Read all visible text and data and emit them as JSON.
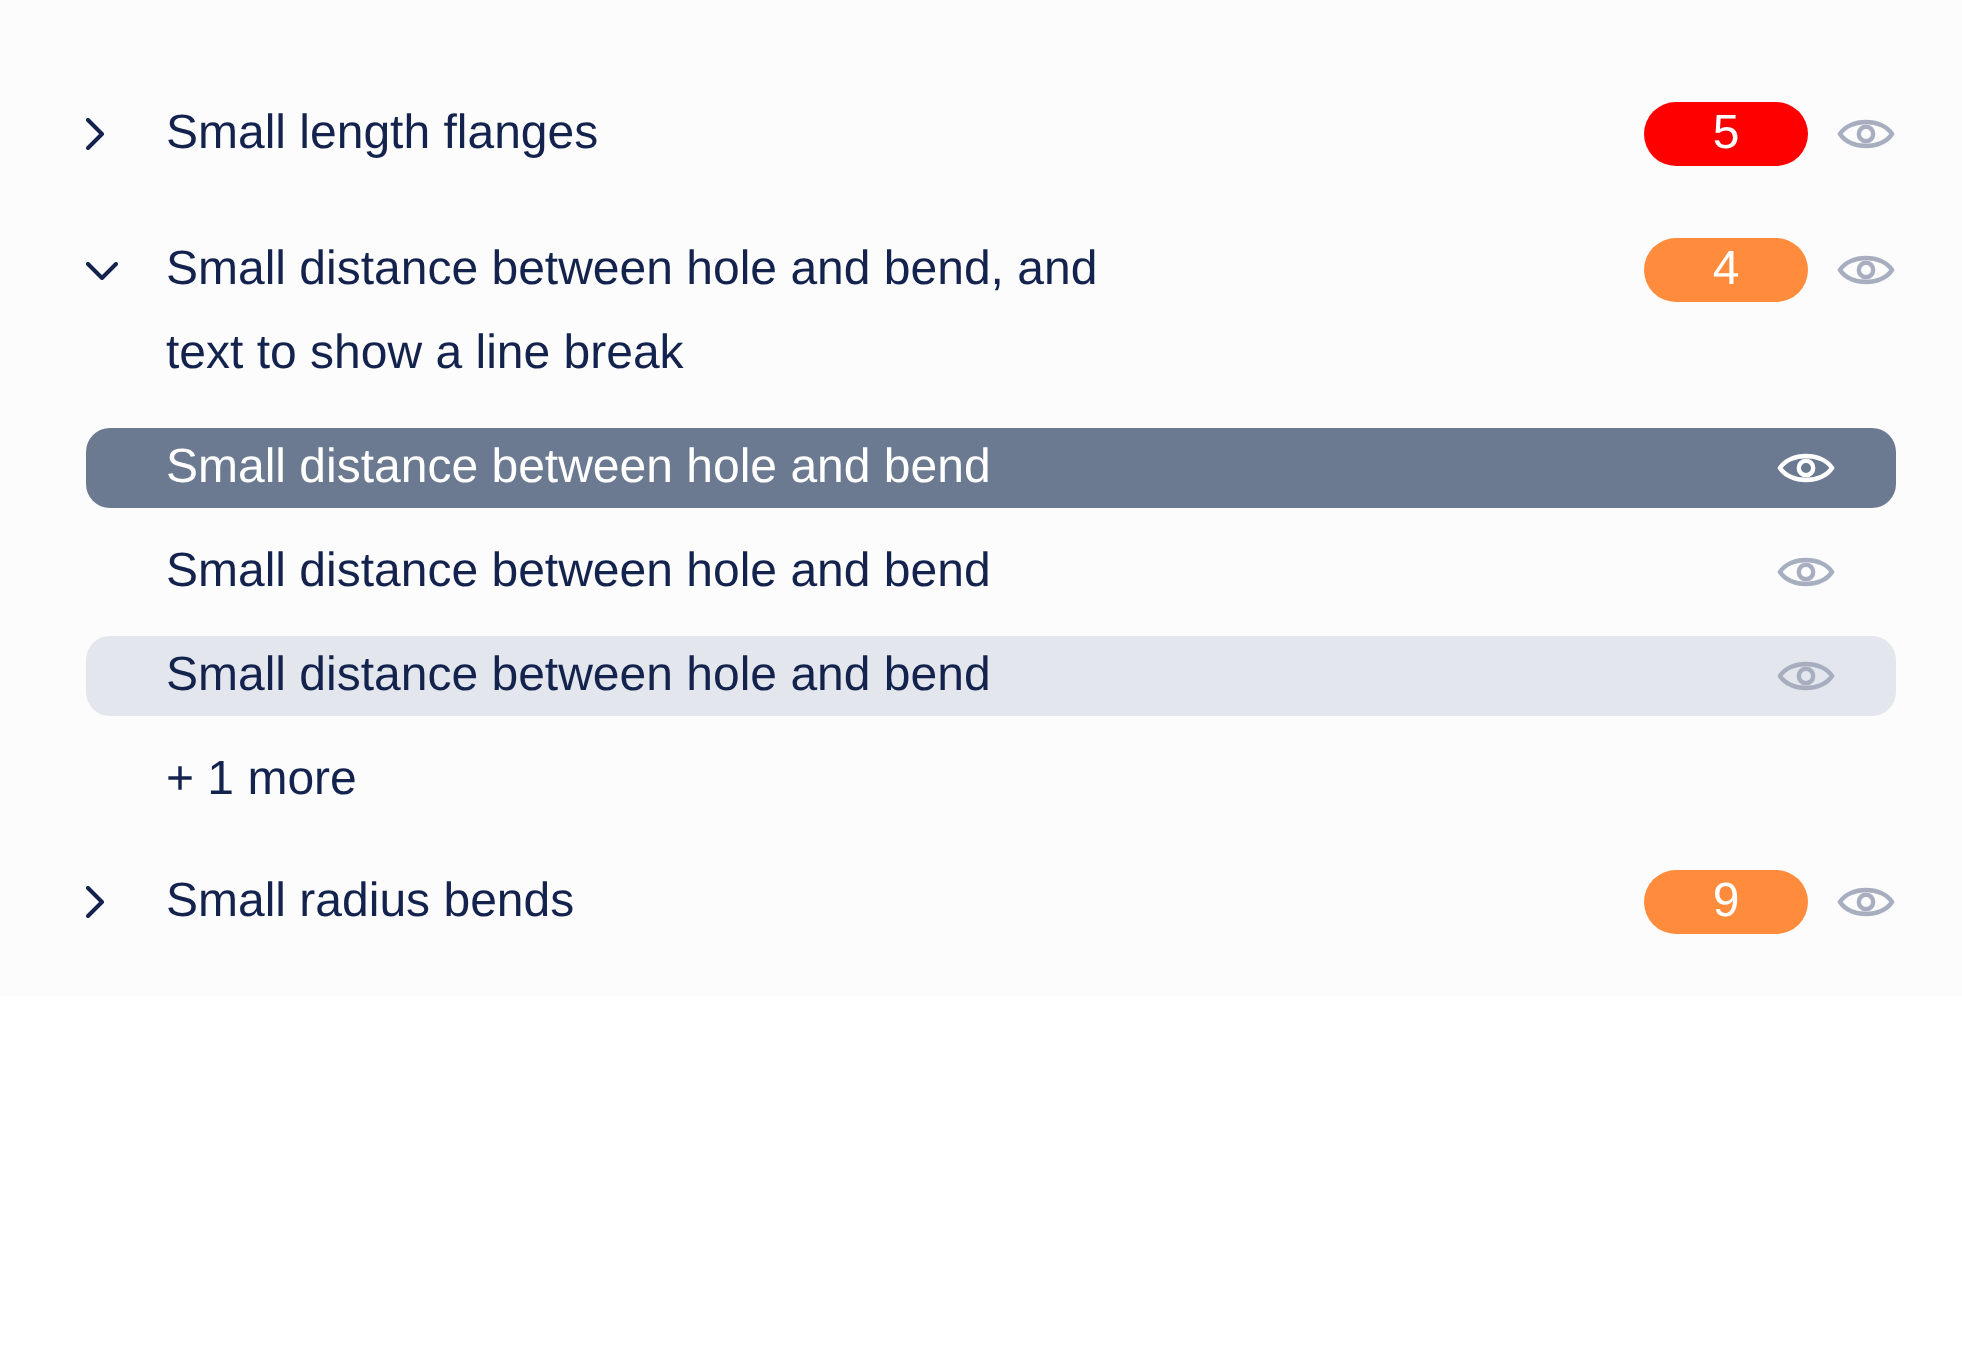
{
  "groups": [
    {
      "label": "Small length flanges",
      "expanded": false,
      "badge": {
        "text": "5",
        "color": "#ff0000"
      }
    },
    {
      "label": "Small distance between hole and bend, and text to show a line break",
      "expanded": true,
      "badge": {
        "text": "4",
        "color": "#ff8c3c"
      },
      "children": [
        {
          "label": "Small distance between hole and bend",
          "selected": true,
          "highlighted": false
        },
        {
          "label": "Small distance between hole and bend",
          "selected": false,
          "highlighted": false
        },
        {
          "label": "Small distance between hole and bend",
          "selected": false,
          "highlighted": true
        }
      ],
      "more": "+ 1 more"
    },
    {
      "label": "Small radius bends",
      "expanded": false,
      "badge": {
        "text": "9",
        "color": "#ff8c3c"
      }
    }
  ]
}
